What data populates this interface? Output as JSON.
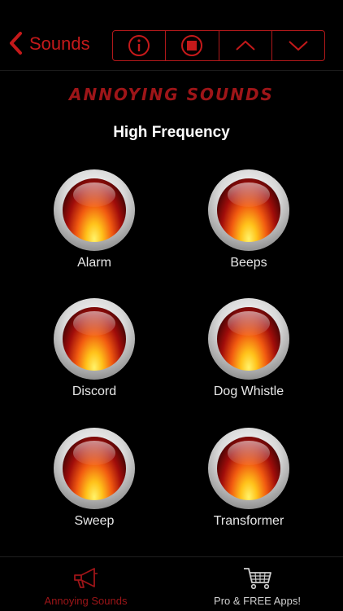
{
  "nav": {
    "back_label": "Sounds",
    "accent": "#c4191a",
    "segments": [
      "info-icon",
      "stop-icon",
      "chevron-up-icon",
      "chevron-down-icon"
    ]
  },
  "logo_text": "ANNOYING SOUNDS",
  "section_title": "High Frequency",
  "sounds": [
    {
      "label": "Alarm"
    },
    {
      "label": "Beeps"
    },
    {
      "label": "Discord"
    },
    {
      "label": "Dog Whistle"
    },
    {
      "label": "Sweep"
    },
    {
      "label": "Transformer"
    }
  ],
  "tabs": [
    {
      "label": "Annoying Sounds",
      "icon": "megaphone-icon",
      "active": true
    },
    {
      "label": "Pro & FREE Apps!",
      "icon": "cart-icon",
      "active": false
    }
  ]
}
